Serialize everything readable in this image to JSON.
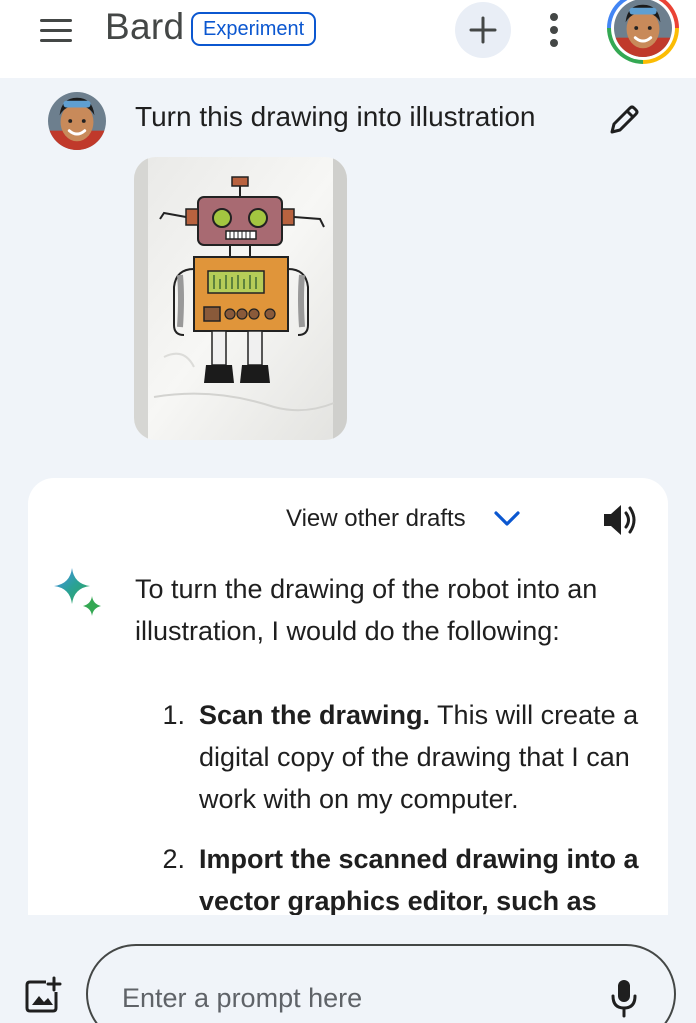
{
  "header": {
    "brand": "Bard",
    "badge": "Experiment",
    "menu_icon": "hamburger-menu-icon",
    "new_chat_icon": "plus-icon",
    "more_icon": "more-vert-icon",
    "avatar_icon": "account-avatar"
  },
  "conversation": {
    "user_prompt": "Turn this drawing into illustration",
    "edit_icon": "pencil-icon",
    "attachment_icon": "robot-drawing-image"
  },
  "response": {
    "drafts_label": "View other drafts",
    "drafts_icon": "chevron-down-icon",
    "listen_icon": "speaker-icon",
    "bot_icon": "sparkle-icon",
    "intro": "To turn the drawing of the robot into an illustration, I would do the following:",
    "steps": [
      {
        "num": "1.",
        "title": "Scan the drawing.",
        "text": " This will create a digital copy of the drawing that I can work with on my computer."
      },
      {
        "num": "2.",
        "title": "Import the scanned drawing into a vector graphics editor, such as",
        "text": ""
      }
    ]
  },
  "input": {
    "placeholder": "Enter a prompt here",
    "image_icon": "add-image-icon",
    "mic_icon": "microphone-icon"
  },
  "colors": {
    "accent": "#0b57d0",
    "background": "#f0f4f9",
    "card": "#ffffff"
  }
}
